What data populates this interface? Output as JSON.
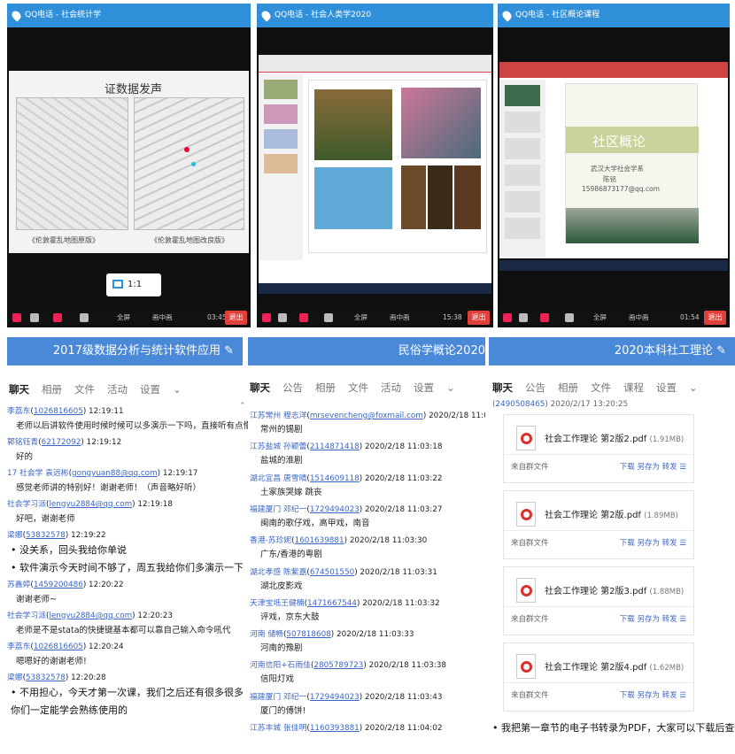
{
  "videos": [
    {
      "title": "QQ电话 - 社会统计学",
      "time": "03:45",
      "fullscreen": "全屏",
      "pip": "画中画",
      "exit": "退出",
      "slide_title": "证数据发声",
      "map_left": "《伦敦霍乱地图原版》",
      "map_right": "《伦敦霍乱地图改良版》",
      "ratio": "1:1"
    },
    {
      "title": "QQ电话 - 社会人类学2020",
      "time": "15:38",
      "fullscreen": "全屏",
      "pip": "画中画",
      "exit": "退出"
    },
    {
      "title": "QQ电话 - 社区概论课程",
      "time": "01:54",
      "fullscreen": "全屏",
      "pip": "画中画",
      "exit": "退出",
      "slide_title": "社区概论",
      "slide_sub": "武汉大学社会学系",
      "slide_name": "陈铭",
      "slide_phone": "15986873177@qq.com"
    }
  ],
  "chats": [
    {
      "title": "2017级数据分析与统计软件应用",
      "tabs": [
        "聊天",
        "相册",
        "文件",
        "活动",
        "设置"
      ],
      "active": "聊天",
      "messages": [
        {
          "name": "李荔东",
          "qq": "1026816605",
          "time": "12:19:11",
          "text": "老师以后讲软件使用时候时候可以多演示一下吗，直接听有点懵"
        },
        {
          "name": "郭铭钰青",
          "qq": "62172092",
          "time": "12:19:12",
          "text": "好的"
        },
        {
          "name": "17 社会学 袁远彬",
          "qq": "gongyuan88@qq.com",
          "time": "12:19:17",
          "text": "感觉老师讲的特别好！谢谢老师！（声音略好听）"
        },
        {
          "name": "社会学习派",
          "qq": "lengyu2884@qq.com",
          "time": "12:19:18",
          "text": "好吧，谢谢老师"
        },
        {
          "name": "梁娜",
          "qq": "53832578",
          "time": "12:19:22",
          "text": "没关系，回头我给你单说"
        },
        {
          "name": "",
          "qq": "",
          "time": "",
          "text": "软件演示今天时间不够了，周五我给你们多演示一下"
        },
        {
          "name": "苏鑫婷",
          "qq": "1459200486",
          "time": "12:20:22",
          "text": "谢谢老师~"
        },
        {
          "name": "社会学习派",
          "qq": "lengyu2884@qq.com",
          "time": "12:20:23",
          "text": "老师是不是stata的快捷键基本都可以靠自己输入命令吼代"
        },
        {
          "name": "李荔东",
          "qq": "1026816605",
          "time": "12:20:24",
          "text": "嗯嗯好的谢谢老师!"
        },
        {
          "name": "梁娜",
          "qq": "53832578",
          "time": "12:20:28",
          "text": "不用担心，今天才第一次课，我们之后还有很多很多使用stata的机会，"
        },
        {
          "name": "",
          "qq": "",
          "time": "",
          "text": "你们一定能学会熟练使用的"
        }
      ]
    },
    {
      "title": "民俗学概论2020",
      "tabs": [
        "聊天",
        "公告",
        "相册",
        "文件",
        "活动",
        "设置"
      ],
      "active": "聊天",
      "messages": [
        {
          "name": "江苏常州 程志洋",
          "qq": "mrsevencheng@foxmail.com",
          "time": "2020/2/18 11:03:07",
          "text": "常州的锡剧"
        },
        {
          "name": "江苏盐城 孙颖蕾",
          "qq": "2114871418",
          "time": "2020/2/18 11:03:18",
          "text": "盐城的淮剧"
        },
        {
          "name": "湖北宜昌 唐雪晴",
          "qq": "1514609118",
          "time": "2020/2/18 11:03:22",
          "text": "土家族哭嫁 跳丧"
        },
        {
          "name": "福建厦门 邓纪一",
          "qq": "1729494023",
          "time": "2020/2/18 11:03:27",
          "text": "闽南的歌仔戏，高甲戏，南音"
        },
        {
          "name": "香港-苏珍妮",
          "qq": "1601639881",
          "time": "2020/2/18 11:03:30",
          "text": "广东/香港的粤剧"
        },
        {
          "name": "湖北孝感 陈紫嘉",
          "qq": "674501550",
          "time": "2020/2/18 11:03:31",
          "text": "湖北皮影戏"
        },
        {
          "name": "天津宝坻王健楠",
          "qq": "1471667544",
          "time": "2020/2/18 11:03:32",
          "text": "评戏，京东大鼓"
        },
        {
          "name": "河南 储畅",
          "qq": "507818608",
          "time": "2020/2/18 11:03:33",
          "text": "河南的豫剧"
        },
        {
          "name": "河南信阳+石雨佳",
          "qq": "2805789723",
          "time": "2020/2/18 11:03:38",
          "text": "信阳灯戏"
        },
        {
          "name": "福建厦门 邓纪一",
          "qq": "1729494023",
          "time": "2020/2/18 11:03:43",
          "text": "厦门的傅饼!"
        },
        {
          "name": "江苏丰城 张佳明",
          "qq": "1160393881",
          "time": "2020/2/18 11:04:02",
          "text": ""
        }
      ]
    },
    {
      "title": "2020本科社工理论",
      "tabs": [
        "聊天",
        "公告",
        "相册",
        "文件",
        "课程",
        "设置"
      ],
      "active": "聊天",
      "top_line": "2020/2/17 13:20:25",
      "files": [
        {
          "name": "社会工作理论 第2版2.pdf",
          "size": "(1.91MB)"
        },
        {
          "name": "社会工作理论 第2版.pdf",
          "size": "(1.89MB)"
        },
        {
          "name": "社会工作理论 第2版3.pdf",
          "size": "(1.88MB)"
        },
        {
          "name": "社会工作理论 第2版4.pdf",
          "size": "(1.62MB)"
        }
      ],
      "from_label": "来自群文件",
      "download": "下载",
      "save_as": "另存为",
      "forward": "转发",
      "last_msg": "我把第一章节的电子书转录为PDF，大家可以下载后查看"
    }
  ]
}
